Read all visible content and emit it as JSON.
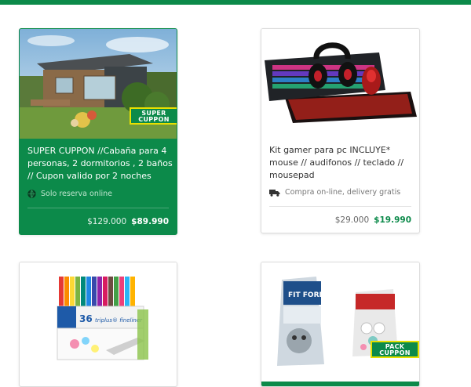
{
  "theme": {
    "accent": "#0c8a4a",
    "badge_border": "#e8e000"
  },
  "cards": [
    {
      "badge": [
        "SUPER",
        "CUPPON"
      ],
      "title": "SUPER CUPPON //Cabaña para 4 personas, 2 dormitorios , 2 baños // Cupon valido por 2 noches",
      "feature": {
        "icon": "globe-icon",
        "text": "Solo reserva online"
      },
      "old_price": "$129.000",
      "new_price": "$89.990"
    },
    {
      "title": "Kit gamer para pc INCLUYE* mouse // audifonos // teclado // mousepad",
      "feature": {
        "icon": "truck-icon",
        "text": "Compra on-line, delivery gratis"
      },
      "old_price": "$29.000",
      "new_price": "$19.990"
    },
    {
      "image_text": {
        "count": "36",
        "brand": "triplus® fineliner"
      }
    },
    {
      "badge": [
        "PACK",
        "CUPPON"
      ],
      "image_text": {
        "brand": "FIT FORMULA"
      }
    }
  ]
}
